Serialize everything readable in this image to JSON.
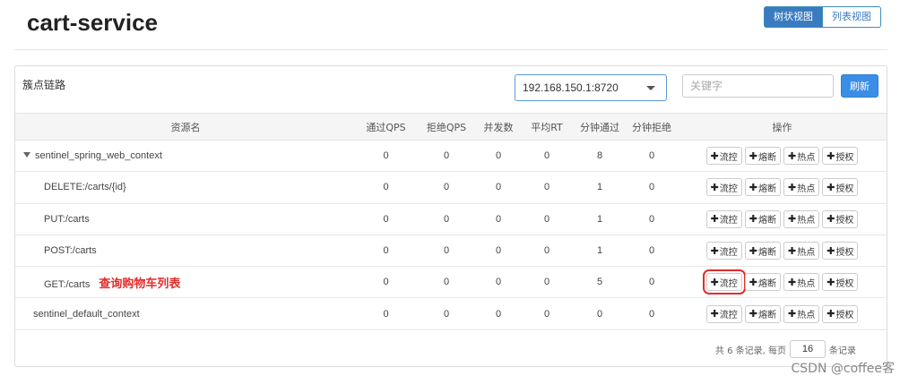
{
  "page": {
    "title": "cart-service"
  },
  "view_toggle": {
    "tree_label": "树状视图",
    "list_label": "列表视图"
  },
  "panel": {
    "label": "簇点链路",
    "ip_select": "192.168.150.1:8720",
    "keyword_placeholder": "关键字",
    "refresh_label": "刷新"
  },
  "table": {
    "headers": [
      "资源名",
      "通过QPS",
      "拒绝QPS",
      "并发数",
      "平均RT",
      "分钟通过",
      "分钟拒绝",
      "操作"
    ],
    "rows": [
      {
        "name": "sentinel_spring_web_context",
        "cells": [
          "0",
          "0",
          "0",
          "0",
          "8",
          "0"
        ]
      },
      {
        "name": "DELETE:/carts/{id}",
        "cells": [
          "0",
          "0",
          "0",
          "0",
          "1",
          "0"
        ]
      },
      {
        "name": "PUT:/carts",
        "cells": [
          "0",
          "0",
          "0",
          "0",
          "1",
          "0"
        ]
      },
      {
        "name": "POST:/carts",
        "cells": [
          "0",
          "0",
          "0",
          "0",
          "1",
          "0"
        ]
      },
      {
        "name": "GET:/carts",
        "annotation": "查询购物车列表",
        "cells": [
          "0",
          "0",
          "0",
          "0",
          "5",
          "0"
        ]
      },
      {
        "name": "sentinel_default_context",
        "cells": [
          "0",
          "0",
          "0",
          "0",
          "0",
          "0"
        ]
      }
    ],
    "actions": [
      "流控",
      "熔断",
      "热点",
      "授权"
    ],
    "plus_glyph": "✚"
  },
  "pager": {
    "text_before": "共 6 条记录, 每页",
    "page_size": "16",
    "text_after": "条记录"
  },
  "watermark": "CSDN @coffee客",
  "colors": {
    "accent": "#3a7bbf",
    "refresh": "#3a8ee6",
    "annotation": "#e32b2b"
  }
}
